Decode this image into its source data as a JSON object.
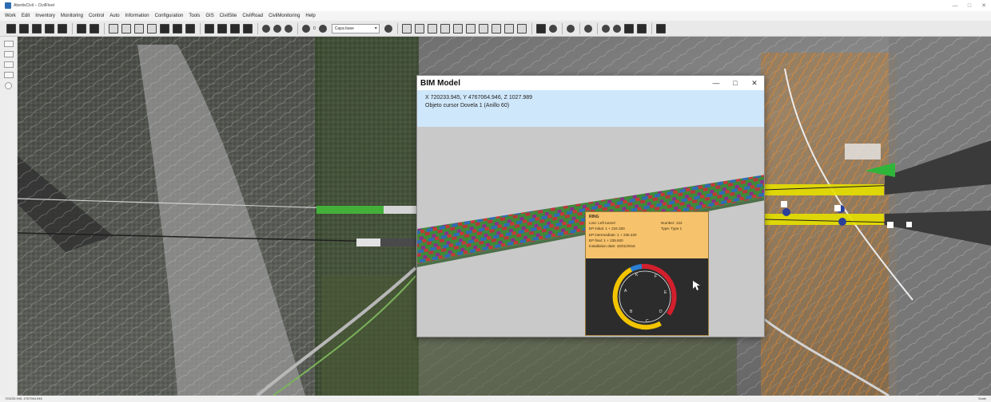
{
  "window": {
    "title": "AbertisCivil – CivilFleet",
    "controls": {
      "minimize": "—",
      "maximize": "□",
      "close": "✕"
    }
  },
  "menu": [
    "Work",
    "Edit",
    "Inventory",
    "Monitoring",
    "Control",
    "Auto",
    "Information",
    "Configuration",
    "Tools",
    "GIS",
    "CivilSite",
    "CivilRoad",
    "CivilMonitoring",
    "Help"
  ],
  "toolbar": {
    "layer_select": "Capa base",
    "zoom_label": "0"
  },
  "bim_window": {
    "title": "BIM Model",
    "controls": {
      "minimize": "—",
      "maximize": "□",
      "close": "✕"
    },
    "coords": "X 720233.945, Y 4767064.946, Z 1027.989",
    "object": "Objeto cursor Dovela 1 (Anillo 60)"
  },
  "ring": {
    "heading": "RING",
    "line1": "Line: Left tunnel",
    "line2": "EP initial: 1 + 234.320",
    "line3": "EP intermediate: 1 + 235.320",
    "line4": "EP final: 1 + 235.920",
    "line5": "Installation date: 15/01/2016",
    "number": "Number: 122",
    "type": "Type: Type 1",
    "segments": [
      "A",
      "B",
      "C",
      "D",
      "E",
      "F",
      "K"
    ]
  },
  "statusbar": {
    "left": "720233.945, 4767064.946",
    "right": "Scale"
  },
  "colors": {
    "ring_yellow": "#f2c400",
    "ring_red": "#d21f2c",
    "ring_blue": "#2a7fd4",
    "info_orange": "#f6c26c",
    "info_blue": "#cfe7fa"
  }
}
